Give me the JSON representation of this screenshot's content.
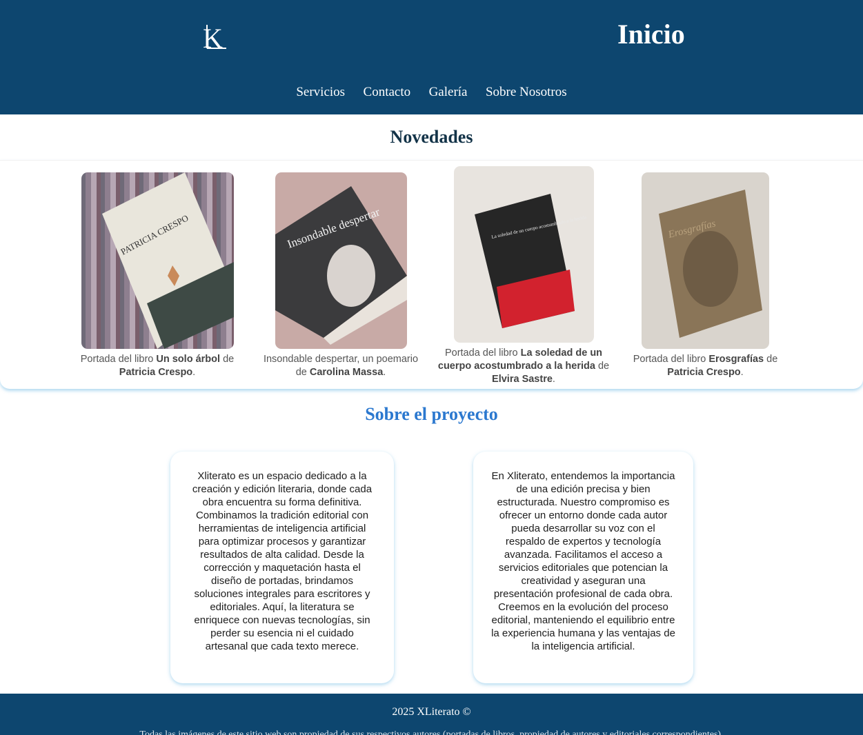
{
  "header": {
    "logo_text": "XL",
    "page_title": "Inicio",
    "nav": [
      "Servicios",
      "Contacto",
      "Galería",
      "Sobre Nosotros"
    ]
  },
  "novedades": {
    "title": "Novedades",
    "books": [
      {
        "caption_pre": "Portada del libro ",
        "title": "Un solo árbol",
        "caption_mid": " de ",
        "author": "Patricia Crespo",
        "caption_post": ".",
        "cover_text": "PATRICIA CRESPO"
      },
      {
        "caption_pre": "Insondable despertar, un poemario de ",
        "title": "",
        "caption_mid": "",
        "author": "Carolina Massa",
        "caption_post": ".",
        "cover_text": "Insondable despertar"
      },
      {
        "caption_pre": "Portada del libro ",
        "title": "La soledad de un cuerpo acostumbrado a la herida",
        "caption_mid": " de ",
        "author": "Elvira Sastre",
        "caption_post": ".",
        "cover_text": "La soledad de un cuerpo acostumbrado a la herida"
      },
      {
        "caption_pre": "Portada del libro ",
        "title": "Erosgrafías",
        "caption_mid": " de ",
        "author": "Patricia Crespo",
        "caption_post": ".",
        "cover_text": "Erosgrafías"
      }
    ]
  },
  "about": {
    "title": "Sobre el proyecto",
    "paragraph_1": "Xliterato es un espacio dedicado a la creación y edición literaria, donde cada obra encuentra su forma definitiva. Combinamos la tradición editorial con herramientas de inteligencia artificial para optimizar procesos y garantizar resultados de alta calidad. Desde la corrección y maquetación hasta el diseño de portadas, brindamos soluciones integrales para escritores y editoriales. Aquí, la literatura se enriquece con nuevas tecnologías, sin perder su esencia ni el cuidado artesanal que cada texto merece.",
    "paragraph_2": "En Xliterato, entendemos la importancia de una edición precisa y bien estructurada. Nuestro compromiso es ofrecer un entorno donde cada autor pueda desarrollar su voz con el respaldo de expertos y tecnología avanzada. Facilitamos el acceso a servicios editoriales que potencian la creatividad y aseguran una presentación profesional de cada obra. Creemos en la evolución del proceso editorial, manteniendo el equilibrio entre la experiencia humana y las ventajas de la inteligencia artificial."
  },
  "footer": {
    "copyright": "2025 XLiterato ©",
    "note": "Todas las imágenes de este sitio web son propiedad de sus respectivos autores (portadas de libros, propiedad de autores y editoriales correspondientes)."
  },
  "colors": {
    "header_bg": "#0d466f",
    "accent": "#2b78cf"
  }
}
